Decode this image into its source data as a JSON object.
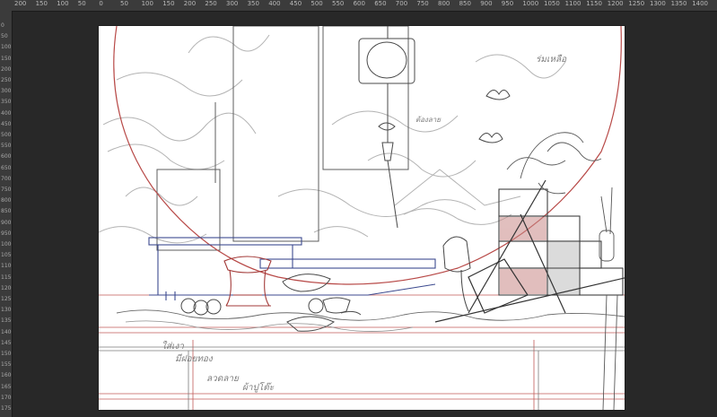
{
  "ruler_top": {
    "labels": [
      "200",
      "150",
      "100",
      "50",
      "0",
      "50",
      "100",
      "150",
      "200",
      "250",
      "300",
      "350",
      "400",
      "450",
      "500",
      "550",
      "600",
      "650",
      "700",
      "750",
      "800",
      "850",
      "900",
      "950",
      "1000",
      "1050",
      "1100",
      "1150",
      "1200",
      "1250",
      "1300",
      "1350",
      "1400"
    ]
  },
  "ruler_left": {
    "labels": [
      "0",
      "50",
      "100",
      "150",
      "200",
      "250",
      "300",
      "350",
      "400",
      "450",
      "500",
      "550",
      "600",
      "650",
      "700",
      "750",
      "800",
      "850",
      "900",
      "950",
      "1000",
      "1050",
      "1100",
      "1150",
      "1200",
      "1250",
      "1300",
      "1350",
      "1400",
      "1450",
      "1500",
      "1550",
      "1600",
      "1650",
      "1700",
      "1750"
    ]
  },
  "canvas": {
    "notes": {
      "top_right": "ร่มเหลือ",
      "lantern": "ต้องลาย",
      "bottom_1": "ใส่เงา",
      "bottom_2": "มีฝอยทอง",
      "bottom_3": "ลวดลาย",
      "bottom_4": "ผ้าปูโต๊ะ"
    },
    "colors": {
      "sketch": "#5a5a5a",
      "light_sketch": "#a9a9a9",
      "red_line": "#b84a48",
      "blue_line": "#3c4a8f",
      "red_fill": "#c98a88"
    }
  }
}
